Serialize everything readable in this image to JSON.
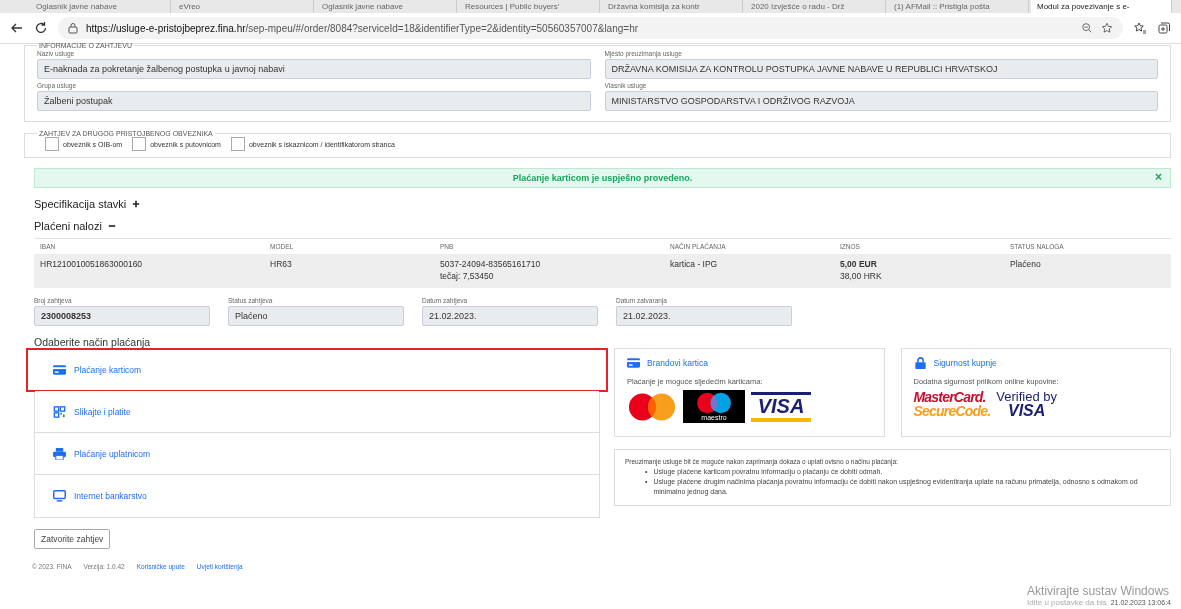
{
  "browser": {
    "tabs": [
      {
        "title": "Oglasnik javne nabave",
        "selected": false
      },
      {
        "title": "eVreo",
        "selected": false
      },
      {
        "title": "Oglasnik javne nabave",
        "selected": false
      },
      {
        "title": "Resources | Public buyers'",
        "selected": false
      },
      {
        "title": "Državna komisija za kontr",
        "selected": false
      },
      {
        "title": "2020 Izvješće o radu - Drž",
        "selected": false
      },
      {
        "title": "(1) AFMail :: Pristigla pošta",
        "selected": false
      },
      {
        "title": "Modul za povezivanje s e-",
        "selected": true
      }
    ],
    "url_host": "https://usluge-e-pristojbeprez.fina.hr",
    "url_path": "/sep-mpeu/#/order/8084?serviceId=18&identifierType=2&identity=50560357007&lang=hr"
  },
  "info": {
    "legend": "INFORMACIJE O ZAHTJEVU",
    "fields": [
      {
        "label": "Naziv usluge",
        "value": "E-naknada za pokretanje žalbenog postupka u javnoj nabavi"
      },
      {
        "label": "Mjesto preuzimanja usluge",
        "value": "DRŽAVNA KOMISIJA ZA KONTROLU POSTUPKA JAVNE NABAVE U REPUBLICI HRVATSKOJ"
      },
      {
        "label": "Grupa usluge",
        "value": "Žalbeni postupak"
      },
      {
        "label": "Vlasnik usluge",
        "value": "MINISTARSTVO GOSPODARSTVA I ODRŽIVOG RAZVOJA"
      }
    ]
  },
  "other_payer": {
    "legend": "ZAHTJEV ZA DRUGOG PRISTOJBENOG OBVEZNIKA",
    "options": [
      {
        "label": "obveznik s OIB-om",
        "checked": false
      },
      {
        "label": "obveznik s putovnicom",
        "checked": false
      },
      {
        "label": "obveznik s iskaznicom / identifikatorom stranca",
        "checked": false
      }
    ]
  },
  "alert": {
    "message": "Plaćanje karticom je uspješno provedeno.",
    "close": "×"
  },
  "sections": [
    {
      "title": "Specifikacija stavki",
      "expanded": false
    },
    {
      "title": "Plaćeni nalozi",
      "expanded": true
    }
  ],
  "table": {
    "columns": [
      "IBAN",
      "MODEL",
      "PNB",
      "NAČIN PLAĆANJA",
      "IZNOS",
      "STATUS NALOGA"
    ],
    "rows": [
      [
        [
          "HR1210010051863000160"
        ],
        [
          "HR63"
        ],
        [
          "5037-24094-83565161710",
          "tečaj: 7,53450"
        ],
        [
          "kartica - IPG"
        ],
        [
          "**5,00 EUR**",
          "38,00 HRK"
        ],
        [
          "Plaćeno"
        ]
      ]
    ]
  },
  "request_fields": [
    {
      "label": "Broj zahtjeva",
      "value": "2300008253",
      "bold": true
    },
    {
      "label": "Status zahtjeva",
      "value": "Plaćeno",
      "bold": false
    },
    {
      "label": "Datum zahtjeva",
      "value": "21.02.2023.",
      "bold": false
    },
    {
      "label": "Datum zatvaranja",
      "value": "21.02.2023.",
      "bold": false
    }
  ],
  "payment": {
    "title": "Odaberite način plaćanja",
    "methods": [
      {
        "kind": "card",
        "label": "Plaćanje karticom",
        "selected": true
      },
      {
        "kind": "qr",
        "label": "Slikajte i platite",
        "selected": false
      },
      {
        "kind": "print",
        "label": "Plaćanje uplatnicom",
        "selected": false
      },
      {
        "kind": "screen",
        "label": "Internet bankarstvo",
        "selected": false
      }
    ],
    "brands": {
      "title": "Brandovi kartica",
      "note": "Plaćanje je moguće sljedećim karticama:",
      "maestro": "maestro",
      "visa": "VISA"
    },
    "security": {
      "title": "Sigurnost kupnje",
      "note": "Dodatna sigurnost prilikom online kupovine:",
      "mc_line1": "MasterCard.",
      "mc_line2": "SecureCode.",
      "vbv_line1": "Verified by",
      "vbv_line2": "VISA"
    },
    "notice": {
      "bullet": "•",
      "intro": "Preuzimanje usluge bit će moguće nakon zaprimanja dokaza o uplati ovisno o načinu plaćanja:",
      "items": [
        "Usluge plaćene karticom povratnu informaciju o plaćanju će dobiti odmah.",
        "Usluge plaćene drugim načinima plaćanja povratnu informaciju će dobiti nakon uspješnog evidentiranja uplate na računu primatelja, odnosno s odmakom od minimalno jednog dana."
      ]
    }
  },
  "close_button": "Zatvorite zahtjev",
  "footer": {
    "copyright": "© 2023. FINA",
    "version": "Verzija: 1.0.42",
    "links": [
      "Korisničke upute",
      "Uvjeti korištenja"
    ]
  },
  "os_overlay": {
    "activation_title": "Aktivirajte sustav Windows",
    "activation_hint": "Idite u postavke da bis",
    "clock": "21.02.2023 13:06:4"
  }
}
